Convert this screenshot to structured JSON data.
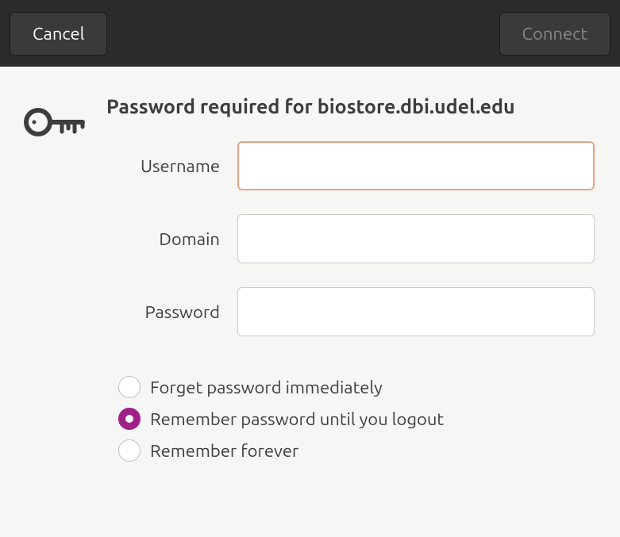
{
  "headerbar": {
    "cancel_label": "Cancel",
    "connect_label": "Connect"
  },
  "dialog": {
    "title": "Password required for biostore.dbi.udel.edu"
  },
  "form": {
    "username_label": "Username",
    "username_value": "",
    "domain_label": "Domain",
    "domain_value": "",
    "password_label": "Password",
    "password_value": ""
  },
  "radio": {
    "options": [
      {
        "label": "Forget password immediately",
        "selected": false
      },
      {
        "label": "Remember password until you logout",
        "selected": true
      },
      {
        "label": "Remember forever",
        "selected": false
      }
    ]
  }
}
